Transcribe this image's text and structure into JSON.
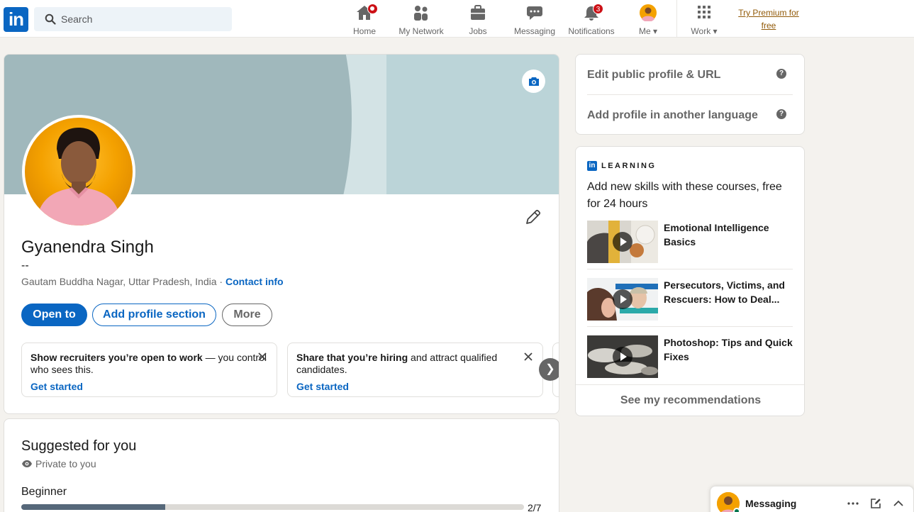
{
  "nav": {
    "search_placeholder": "Search",
    "items": [
      {
        "label": "Home",
        "icon": "home-icon"
      },
      {
        "label": "My Network",
        "icon": "network-icon"
      },
      {
        "label": "Jobs",
        "icon": "jobs-icon"
      },
      {
        "label": "Messaging",
        "icon": "messaging-icon"
      },
      {
        "label": "Notifications",
        "icon": "bell-icon",
        "badge": "3"
      },
      {
        "label": "Me",
        "icon": "avatar"
      },
      {
        "label": "Work",
        "icon": "grid-icon"
      }
    ],
    "premium": "Try Premium for free"
  },
  "profile": {
    "name": "Gyanendra Singh",
    "headline": "--",
    "location": "Gautam Buddha Nagar, Uttar Pradesh, India",
    "separator": "·",
    "contact": "Contact info",
    "buttons": {
      "open_to": "Open to",
      "add_section": "Add profile section",
      "more": "More"
    },
    "cards": [
      {
        "bold": "Show recruiters you’re open to work",
        "rest": " — you control who sees this.",
        "cta": "Get started"
      },
      {
        "bold": "Share that you’re hiring",
        "rest": " and attract qualified candidates.",
        "cta": "Get started"
      }
    ]
  },
  "suggested": {
    "title": "Suggested for you",
    "private": "Private to you",
    "level": "Beginner",
    "progress": "2/7",
    "progress_fraction": 0.2857
  },
  "rail": {
    "links": [
      "Edit public profile & URL",
      "Add profile in another language"
    ],
    "learning": {
      "brand_word": "LEARNING",
      "brand_logo": "in",
      "subtitle": "Add new skills with these courses, free for 24 hours",
      "courses": [
        {
          "title": "Emotional Intelligence Basics"
        },
        {
          "title": "Persecutors, Victims, and Rescuers: How to Deal..."
        },
        {
          "title": "Photoshop: Tips and Quick Fixes"
        }
      ],
      "see_more": "See my recommendations"
    }
  },
  "messaging": {
    "label": "Messaging"
  },
  "colors": {
    "brand": "#0a66c2",
    "badge": "#cc1016",
    "premium": "#915907"
  }
}
